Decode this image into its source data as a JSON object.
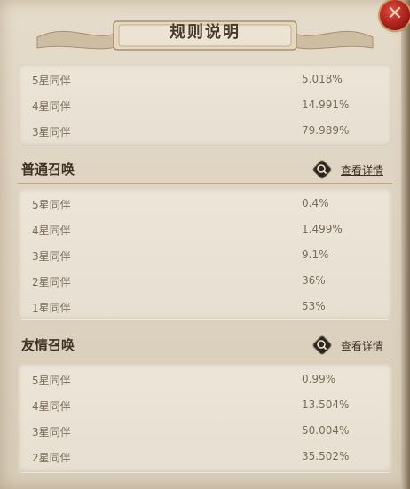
{
  "title": "规则说明",
  "close_icon": "close-icon",
  "panel_top": {
    "rows": [
      {
        "label": "5星同伴",
        "value": "5.018%"
      },
      {
        "label": "4星同伴",
        "value": "14.991%"
      },
      {
        "label": "3星同伴",
        "value": "79.989%"
      }
    ]
  },
  "sections": [
    {
      "name": "普通召唤",
      "detail_label": "查看详情",
      "rows": [
        {
          "label": "5星同伴",
          "value": "0.4%"
        },
        {
          "label": "4星同伴",
          "value": "1.499%"
        },
        {
          "label": "3星同伴",
          "value": "9.1%"
        },
        {
          "label": "2星同伴",
          "value": "36%"
        },
        {
          "label": "1星同伴",
          "value": "53%"
        }
      ]
    },
    {
      "name": "友情召唤",
      "detail_label": "查看详情",
      "rows": [
        {
          "label": "5星同伴",
          "value": "0.99%"
        },
        {
          "label": "4星同伴",
          "value": "13.504%"
        },
        {
          "label": "3星同伴",
          "value": "50.004%"
        },
        {
          "label": "2星同伴",
          "value": "35.502%"
        }
      ]
    }
  ],
  "colors": {
    "close_red": "#a61d1a",
    "text_dark": "#3f3325",
    "text_muted": "#7b6c59"
  }
}
